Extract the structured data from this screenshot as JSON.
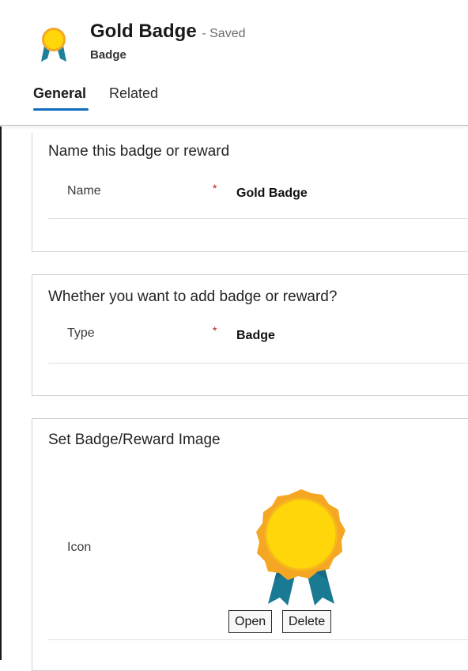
{
  "record": {
    "title": "Gold Badge",
    "status": "- Saved",
    "entity": "Badge"
  },
  "tabs": [
    {
      "label": "General",
      "selected": true
    },
    {
      "label": "Related",
      "selected": false
    }
  ],
  "sections": [
    {
      "title": "Name this badge or reward",
      "field": {
        "label": "Name",
        "required_marker": "*",
        "value": "Gold Badge"
      }
    },
    {
      "title": "Whether you want to add badge or reward?",
      "field": {
        "label": "Type",
        "required_marker": "*",
        "value": "Badge"
      }
    },
    {
      "title": "Set Badge/Reward Image",
      "field": {
        "label": "Icon",
        "image": "gold-badge-ribbon-icon"
      },
      "buttons": {
        "open": "Open",
        "delete": "Delete"
      }
    }
  ],
  "colors": {
    "accent": "#0f6cbd",
    "required": "#c50f1f",
    "badge_gold": "#ffd60a",
    "badge_rim": "#f5a623",
    "ribbon": "#1e7f9a"
  }
}
